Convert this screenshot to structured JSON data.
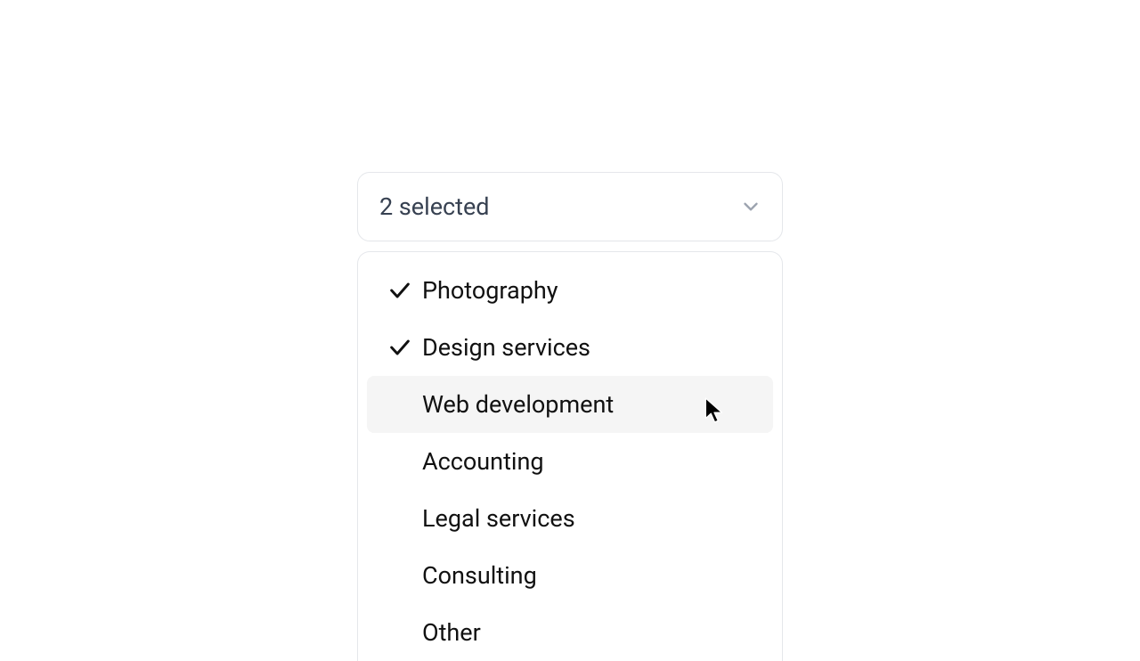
{
  "select": {
    "summary": "2 selected",
    "options": [
      {
        "label": "Photography",
        "selected": true,
        "highlighted": false
      },
      {
        "label": "Design services",
        "selected": true,
        "highlighted": false
      },
      {
        "label": "Web development",
        "selected": false,
        "highlighted": true
      },
      {
        "label": "Accounting",
        "selected": false,
        "highlighted": false
      },
      {
        "label": "Legal services",
        "selected": false,
        "highlighted": false
      },
      {
        "label": "Consulting",
        "selected": false,
        "highlighted": false
      },
      {
        "label": "Other",
        "selected": false,
        "highlighted": false
      }
    ]
  }
}
